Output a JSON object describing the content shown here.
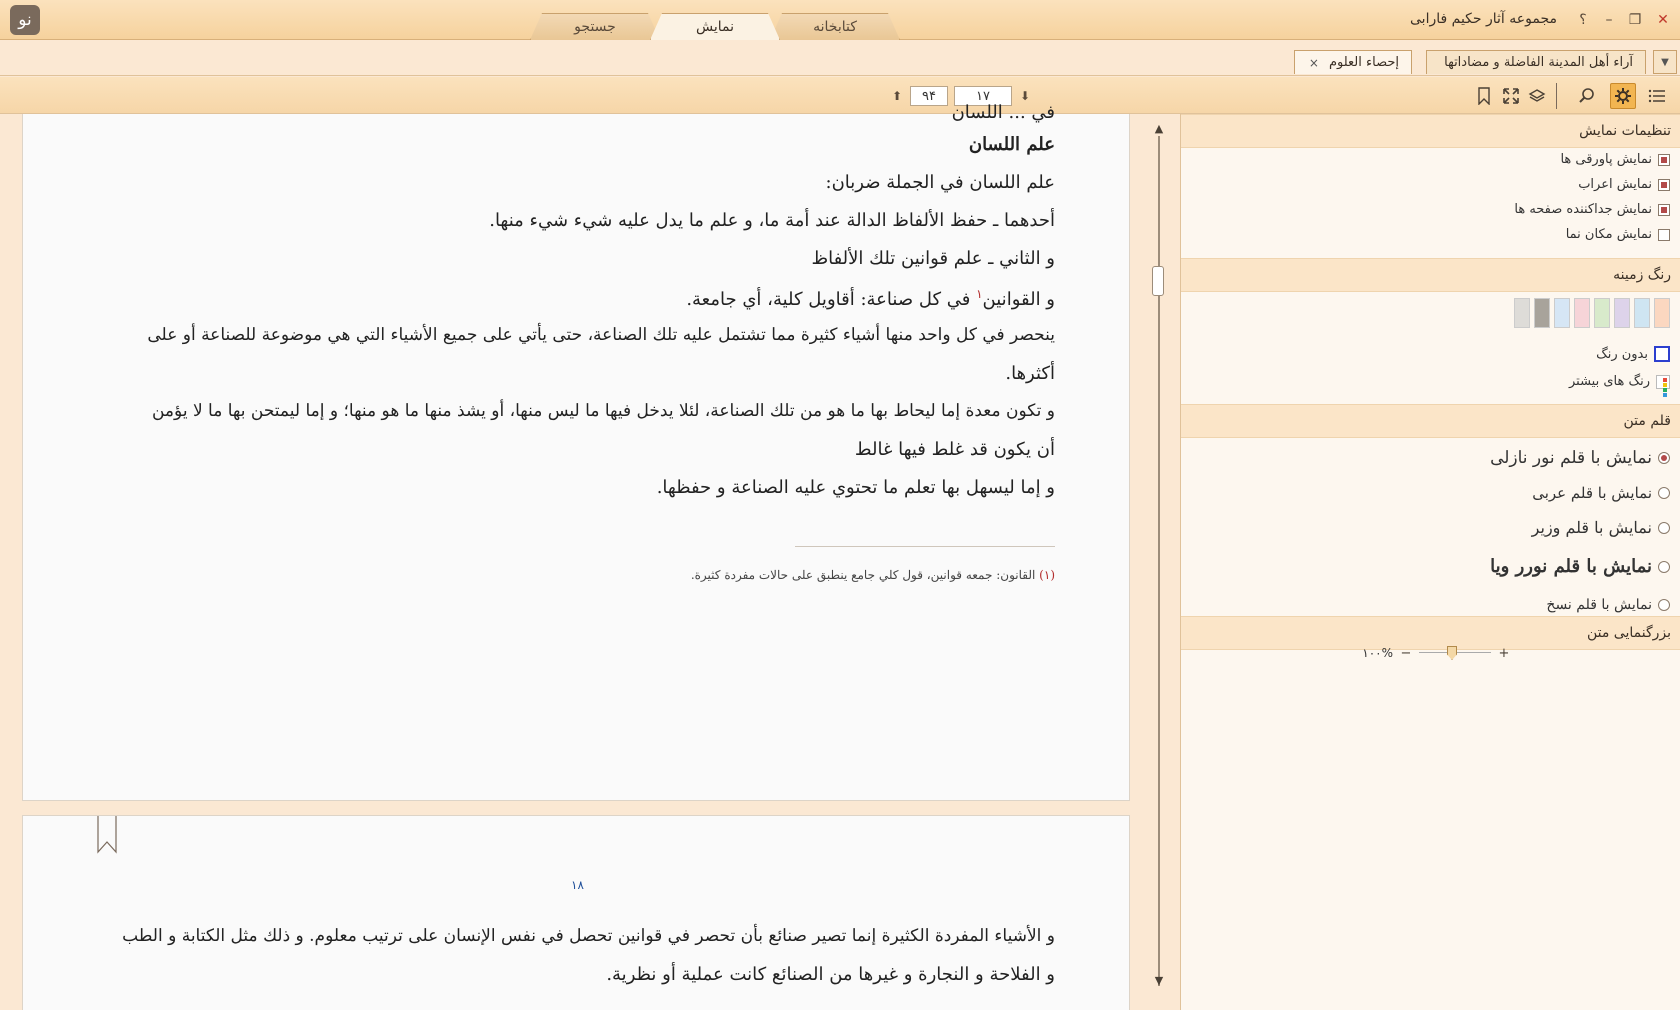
{
  "app": {
    "title": "مجموعه آثار حکیم فارابی",
    "logo_text": "نو",
    "main_tabs": [
      {
        "label": "جستجو",
        "active": false
      },
      {
        "label": "نمایش",
        "active": true
      },
      {
        "label": "کتابخانه",
        "active": false
      }
    ],
    "window_buttons": {
      "help": "؟",
      "minimize": "–",
      "restore": "❐",
      "close": "✕"
    }
  },
  "doc_tabs": [
    {
      "label": "آراء أهل المدينة الفاضلة و مضاداتها",
      "active": false
    },
    {
      "label": "إحصاء العلوم",
      "active": true,
      "close": "×"
    }
  ],
  "toolbar": {
    "page_current": "۱۷",
    "page_total": "۹۴",
    "prev_arrow": "⬆",
    "next_arrow": "⬇",
    "icons": [
      "list-icon",
      "gear-icon",
      "search-icon",
      "layers-icon",
      "fullscreen-icon",
      "bookmark-icon"
    ]
  },
  "page1": {
    "top_fragment": "في ... اللسان",
    "heading": "علم اللسان",
    "lines": [
      "علم اللسان في الجملة ضربان:",
      "أحدهما ـ حفظ الألفاظ الدالة عند أمة ما، و علم ما يدل عليه شيء شيء منها.",
      "و الثاني ـ علم قوانين تلك الألفاظ",
      "في كل صناعة: أقاويل كلية، أي جامعة.",
      "ينحصر في كل واحد منها أشياء كثيرة مما تشتمل عليه تلك الصناعة، حتى يأتي على جميع الأشياء التي هي موضوعة للصناعة أو على",
      "أكثرها.",
      "و تكون معدة إما ليحاط بها ما هو من تلك الصناعة، لئلا يدخل فيها ما ليس منها، أو يشذ منها ما هو منها؛ و إما ليمتحن بها ما لا يؤمن",
      "أن يكون قد غلط فيها غالط",
      "و إما ليسهل بها تعلم ما تحتوي عليه الصناعة و حفظها."
    ],
    "line4_prefix": "و القوانين",
    "footnote_mark": "۱",
    "footnote_num": "(۱)",
    "footnote_text": "القانون: جمعه قوانين، قول كلي جامع ينطبق على حالات مفردة كثيرة."
  },
  "page2": {
    "page_number": "۱۸",
    "lines": [
      "و الأشياء المفردة الكثيرة إنما تصير صنائع بأن تحصر في قوانين تحصل في نفس الإنسان على ترتيب معلوم. و ذلك مثل الكتابة و الطب",
      "و الفلاحة و النجارة و غيرها من الصنائع كانت عملية أو نظرية."
    ]
  },
  "panel": {
    "display_settings": {
      "title": "تنظیمات نمایش",
      "options": [
        {
          "label": "نمایش پاورقی ها",
          "checked": true
        },
        {
          "label": "نمایش اعراب",
          "checked": true
        },
        {
          "label": "نمایش جداکننده صفحه ها",
          "checked": true
        },
        {
          "label": "نمایش مکان نما",
          "checked": false
        }
      ]
    },
    "background_color": {
      "title": "رنگ زمینه",
      "swatches": [
        "#fbd7c0",
        "#cfe5f2",
        "#ddd3ea",
        "#d8eacb",
        "#f6d4d8",
        "#d6e6f5",
        "#a8a39b",
        "#dedcd8"
      ],
      "no_color": "بدون رنگ",
      "more_colors": "رنگ های بیشتر"
    },
    "text_font": {
      "title": "قلم متن",
      "options": [
        {
          "label": "نمایش با قلم نور نازلی",
          "selected": true
        },
        {
          "label": "نمایش با قلم عربی",
          "selected": false
        },
        {
          "label": "نمایش با قلم وزیر",
          "selected": false
        },
        {
          "label": "نمایش با قلم نورر ویا",
          "selected": false
        },
        {
          "label": "نمایش با قلم نسخ",
          "selected": false
        }
      ]
    },
    "zoom": {
      "title": "بزرگنمایی متن",
      "value": "۱۰۰%",
      "minus": "−",
      "plus": "+",
      "level": 1.0
    }
  }
}
